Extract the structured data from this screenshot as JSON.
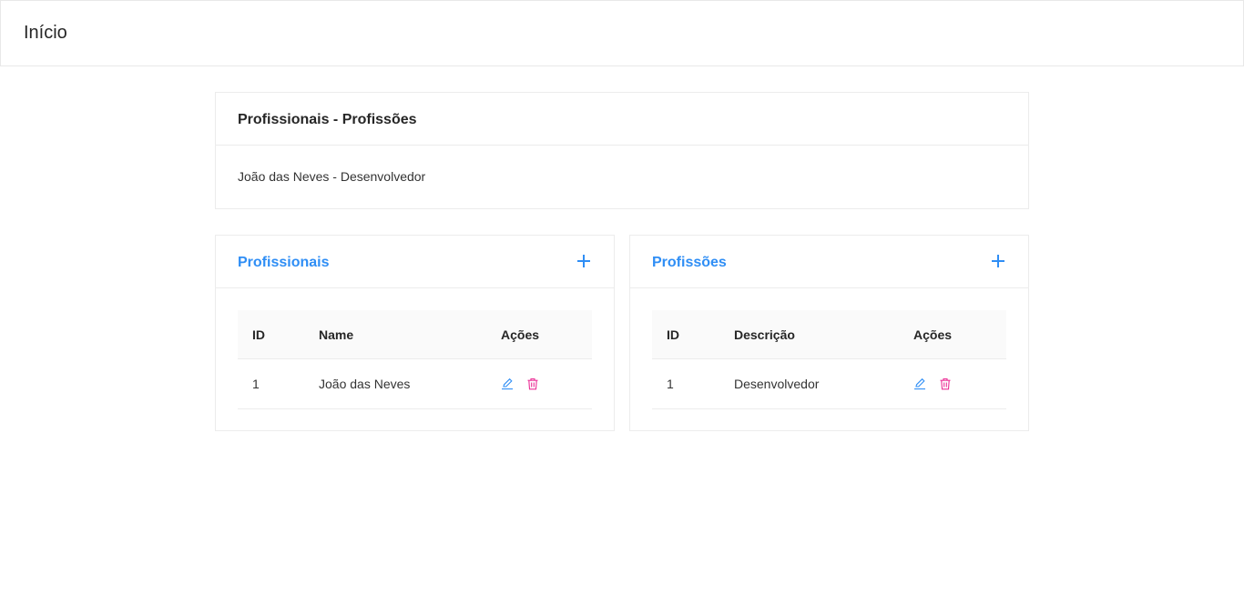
{
  "header": {
    "title": "Início"
  },
  "summary": {
    "title": "Profissionais - Profissões",
    "items": [
      "João das Neves - Desenvolvedor"
    ]
  },
  "profissionais": {
    "title": "Profissionais",
    "add_icon": "plus-icon",
    "columns": [
      "ID",
      "Name",
      "Ações"
    ],
    "rows": [
      {
        "id": "1",
        "name": "João das Neves"
      }
    ]
  },
  "profissoes": {
    "title": "Profissões",
    "add_icon": "plus-icon",
    "columns": [
      "ID",
      "Descrição",
      "Ações"
    ],
    "rows": [
      {
        "id": "1",
        "descricao": "Desenvolvedor"
      }
    ]
  },
  "colors": {
    "accent": "#2f8ef5",
    "danger": "#eb2f96",
    "edit_icon": "edit-icon",
    "delete_icon": "trash-icon"
  }
}
